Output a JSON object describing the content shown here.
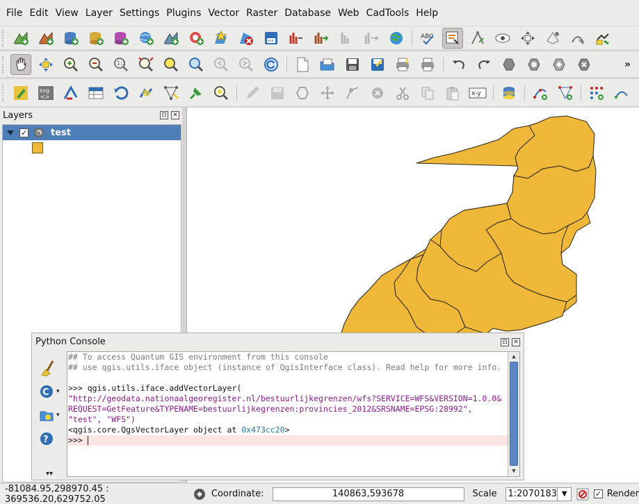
{
  "menubar": {
    "items": [
      {
        "label": "File"
      },
      {
        "label": "Edit"
      },
      {
        "label": "View"
      },
      {
        "label": "Layer"
      },
      {
        "label": "Settings"
      },
      {
        "label": "Plugins"
      },
      {
        "label": "Vector"
      },
      {
        "label": "Raster"
      },
      {
        "label": "Database"
      },
      {
        "label": "Web"
      },
      {
        "label": "CadTools"
      },
      {
        "label": "Help"
      }
    ]
  },
  "toolbars": {
    "overflow": "»",
    "svg_button": "svg\n< >",
    "xy_button": "x-y"
  },
  "layers_panel": {
    "title": "Layers",
    "float_glyph": "⊡",
    "close_glyph": "✕",
    "layer": {
      "name": "test",
      "checked": "✓"
    },
    "legend_color": "#efb839"
  },
  "python_console": {
    "title": "Python Console",
    "float_glyph": "⊡",
    "close_glyph": "✕",
    "lines": {
      "l1": "## To access Quantum GIS environment from this console",
      "l2": "## use qgis.utils.iface object (instance of QgisInterface class). Read help for more info.",
      "l3": "",
      "l4": ">>> qgis.utils.iface.addVectorLayer(",
      "l5": "\"http://geodata.nationaalgeoregister.nl/bestuurlijkegrenzen/wfs?SERVICE=WFS&VERSION=1.0.0&",
      "l6": "REQUEST=GetFeature&TYPENAME=bestuurlijkegrenzen:provincies_2012&SRSNAME=EPSG:28992\",",
      "l7": "\"test\", \"WFS\")",
      "l8_prefix": "<qgis.core.QgsVectorLayer object at ",
      "l8_hex": "0x473cc20",
      "l8_suffix": ">",
      "l9": ">>> "
    }
  },
  "statusbar": {
    "extent": "-81084.95,298970.45 : 369536.20,629752.05",
    "coordinate_label": "Coordinate:",
    "coordinate_value": "140863,593678",
    "scale_label": "Scale",
    "scale_value": "1:2070183",
    "render_checked": "✓",
    "render_label": "Render"
  },
  "colors": {
    "map_fill": "#efb839",
    "map_stroke": "#2b2418",
    "selection": "#4f7fb8"
  }
}
